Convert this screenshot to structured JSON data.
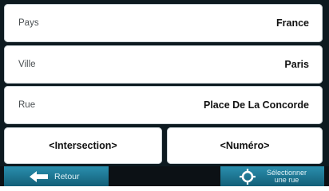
{
  "fields": [
    {
      "label": "Pays",
      "value": "France"
    },
    {
      "label": "Ville",
      "value": "Paris"
    },
    {
      "label": "Rue",
      "value": "Place De La Concorde"
    }
  ],
  "buttons": {
    "intersection": "<Intersection>",
    "numero": "<Numéro>"
  },
  "bottom_bar": {
    "back_label": "Retour",
    "select_label_line1": "Sélectionner",
    "select_label_line2": "une rue"
  },
  "icons": {
    "back": "arrow-left-icon",
    "select": "crosshair-icon"
  }
}
